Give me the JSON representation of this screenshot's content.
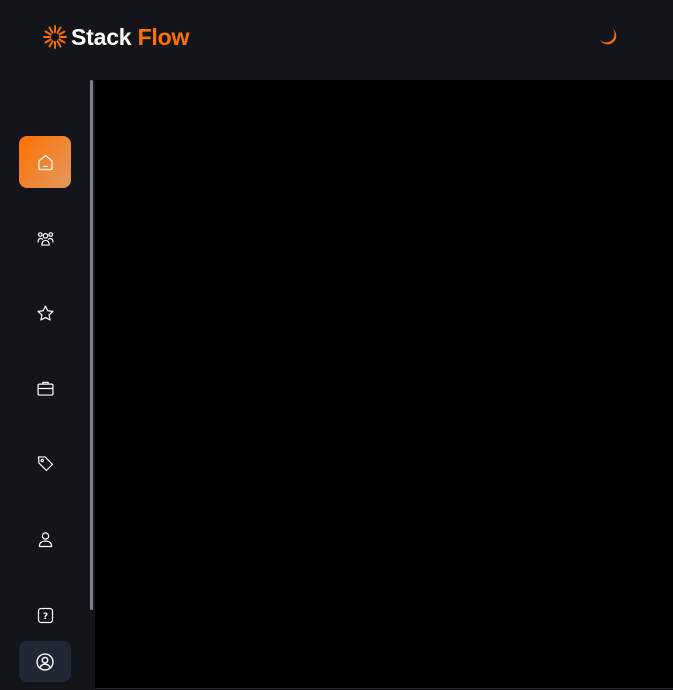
{
  "header": {
    "brand": {
      "logo_icon": "sunburst-logo-icon",
      "name_part1": "Stack",
      "name_part2": "Flow",
      "accent_color": "#ff7000"
    },
    "theme_toggle_icon": "moon-icon"
  },
  "sidebar": {
    "items": [
      {
        "icon": "home-icon",
        "active": true
      },
      {
        "icon": "community-icon",
        "active": false
      },
      {
        "icon": "star-icon",
        "active": false
      },
      {
        "icon": "briefcase-icon",
        "active": false
      },
      {
        "icon": "tag-icon",
        "active": false
      },
      {
        "icon": "user-icon",
        "active": false
      },
      {
        "icon": "question-icon",
        "active": false
      }
    ],
    "profile_button_icon": "user-circle-icon"
  },
  "colors": {
    "background": "#000000",
    "panel": "#13151a",
    "active_gradient_start": "#ff7000",
    "active_gradient_end": "#e2995f",
    "profile_button_bg": "#212734",
    "icon": "#ffffff"
  }
}
